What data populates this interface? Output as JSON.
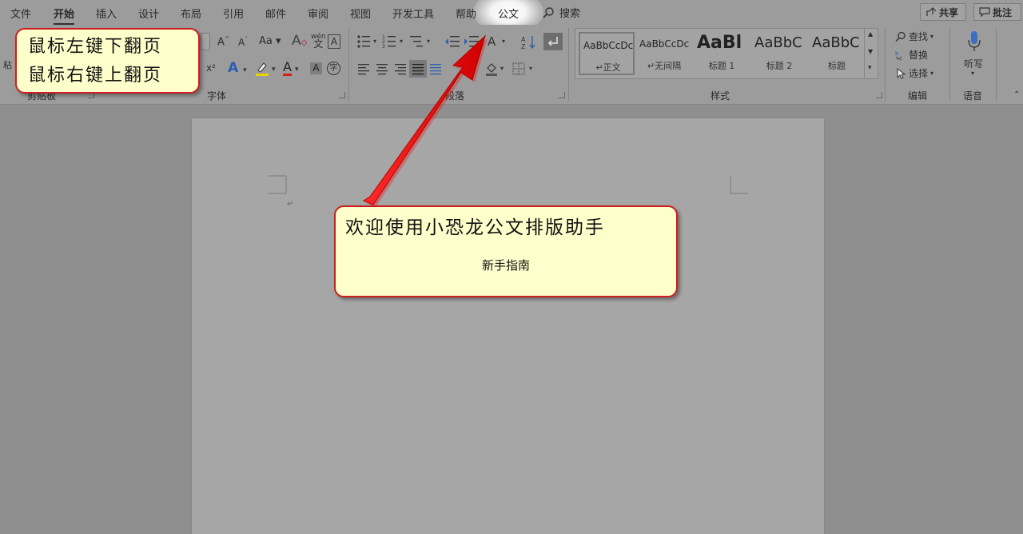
{
  "tabs": [
    {
      "label": "文件",
      "active": false
    },
    {
      "label": "开始",
      "active": true
    },
    {
      "label": "插入",
      "active": false
    },
    {
      "label": "设计",
      "active": false
    },
    {
      "label": "布局",
      "active": false
    },
    {
      "label": "引用",
      "active": false
    },
    {
      "label": "邮件",
      "active": false
    },
    {
      "label": "审阅",
      "active": false
    },
    {
      "label": "视图",
      "active": false
    },
    {
      "label": "开发工具",
      "active": false
    },
    {
      "label": "帮助",
      "active": false
    },
    {
      "label": "公文",
      "active": false
    }
  ],
  "search": {
    "label": "搜索",
    "icon": "search-icon"
  },
  "header_buttons": {
    "share": "共享",
    "comment": "批注"
  },
  "ribbon": {
    "groups": {
      "clipboard": "剪贴板",
      "font": "字体",
      "paragraph": "段落",
      "styles": "样式",
      "editing": "编辑",
      "voice": "语音"
    },
    "font": {
      "grow": "A",
      "shrink": "A",
      "case": "Aa",
      "superscript": "x²",
      "wen": "wén",
      "border_char": "A",
      "font_color": "A",
      "shade": "A",
      "circle": "字"
    },
    "styles": [
      {
        "sample": "AaBbCcDc",
        "name": "正文",
        "selected": true,
        "big": false
      },
      {
        "sample": "AaBbCcDc",
        "name": "无间隔",
        "selected": false,
        "big": false
      },
      {
        "sample": "AaBl",
        "name": "标题 1",
        "selected": false,
        "big": true
      },
      {
        "sample": "AaBbC",
        "name": "标题 2",
        "selected": false,
        "big": false
      },
      {
        "sample": "AaBbC",
        "name": "标题",
        "selected": false,
        "big": false
      }
    ],
    "editing": {
      "find": "查找",
      "replace": "替换",
      "select": "选择"
    },
    "voice": {
      "dictate": "听写"
    }
  },
  "tip_callout": {
    "line1": "鼠标左键下翻页",
    "line2": "鼠标右键上翻页"
  },
  "welcome_callout": {
    "title": "欢迎使用小恐龙公文排版助手",
    "link": "新手指南"
  },
  "colors": {
    "highlight": "#e8d200",
    "font_color": "#d21f1f",
    "callout_border": "#cc1e1e",
    "callout_fill": "#ffffcc",
    "arrow": "#ee1111"
  }
}
